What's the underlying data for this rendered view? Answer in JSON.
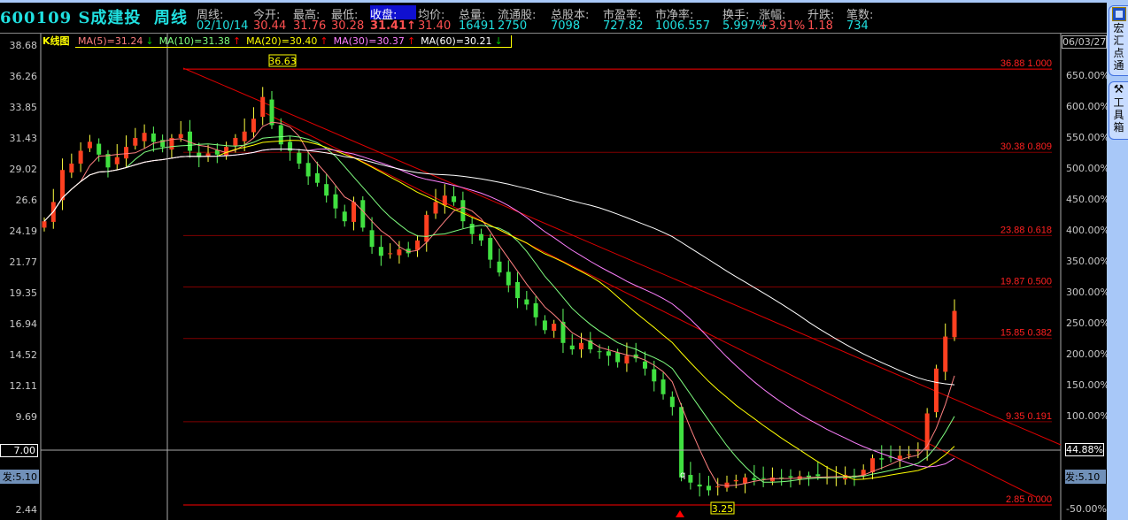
{
  "header": {
    "code": "600109",
    "name": "S成建投",
    "period": "周线",
    "fields": [
      {
        "label": "周线:",
        "value": "02/10/14",
        "color": "#20e0e0"
      },
      {
        "label": "今开:",
        "value": "30.44",
        "color": "#ff5050"
      },
      {
        "label": "最高:",
        "value": "31.76",
        "color": "#ff5050"
      },
      {
        "label": "最低:",
        "value": "30.28",
        "color": "#ff5050"
      },
      {
        "label": "收盘:",
        "value": "31.41↑",
        "color": "#ff5050",
        "highlight": true
      },
      {
        "label": "均价:",
        "value": "31.40",
        "color": "#ff5050"
      },
      {
        "label": "总量:",
        "value": "16491",
        "color": "#20e0e0"
      },
      {
        "label": "流通股:",
        "value": "2750",
        "color": "#20e0e0"
      },
      {
        "label": "总股本:",
        "value": "7098",
        "color": "#20e0e0"
      },
      {
        "label": "市盈率:",
        "value": "727.82",
        "color": "#20e0e0"
      },
      {
        "label": "市净率:",
        "value": "1006.557",
        "color": "#20e0e0"
      },
      {
        "label": "换手:",
        "value": "5.997%",
        "color": "#20e0e0"
      },
      {
        "label": "涨幅:",
        "value": "+3.91%",
        "color": "#ff5050"
      },
      {
        "label": "升跌:",
        "value": "1.18",
        "color": "#ff5050"
      },
      {
        "label": "笔数:",
        "value": "734",
        "color": "#20e0e0"
      }
    ]
  },
  "legend": {
    "chart_label": "K线图",
    "ma": [
      {
        "text": "MA(5)=31.24",
        "arrow": "↓",
        "color": "#ff8080",
        "arrow_color": "#00c000"
      },
      {
        "text": "MA(10)=31.38",
        "arrow": "↑",
        "color": "#80ff80",
        "arrow_color": "#ff0000"
      },
      {
        "text": "MA(20)=30.40",
        "arrow": "↑",
        "color": "#ffff00",
        "arrow_color": "#ff0000"
      },
      {
        "text": "MA(30)=30.37",
        "arrow": "↑",
        "color": "#ff80ff",
        "arrow_color": "#ff0000"
      },
      {
        "text": "MA(60)=30.21",
        "arrow": "↓",
        "color": "#ffffff",
        "arrow_color": "#00c000"
      }
    ]
  },
  "sidebar": {
    "tabs": [
      {
        "label": "宏汇点通",
        "icon": "hongdian-logo-icon"
      },
      {
        "label": "工具箱",
        "icon": "tools-icon"
      }
    ]
  },
  "chart_data": {
    "type": "candlestick",
    "ylim": [
      2.44,
      38.68
    ],
    "left_ticks": [
      "38.68",
      "36.26",
      "33.85",
      "31.43",
      "29.02",
      "26.6",
      "24.19",
      "21.77",
      "19.35",
      "16.94",
      "14.52",
      "12.11",
      "9.69",
      "2.44"
    ],
    "right_ticks": [
      "650.00%",
      "600.00%",
      "550.00%",
      "500.00%",
      "450.00%",
      "400.00%",
      "350.00%",
      "300.00%",
      "250.00%",
      "200.00%",
      "150.00%",
      "100.00%",
      "-50.00%"
    ],
    "crosshair": {
      "price": "7.00",
      "percent": "44.88%"
    },
    "issue_price_label": "发:5.10",
    "date_label": "06/03/27",
    "high_mark": "36.63",
    "low_mark": "3.25",
    "point_marker": "q",
    "fib_levels": [
      {
        "price": "36.88",
        "ratio": "1.000"
      },
      {
        "price": "30.38",
        "ratio": "0.809"
      },
      {
        "price": "23.88",
        "ratio": "0.618"
      },
      {
        "price": "19.87",
        "ratio": "0.500"
      },
      {
        "price": "15.85",
        "ratio": "0.382"
      },
      {
        "price": "9.35",
        "ratio": "0.191"
      },
      {
        "price": "2.85",
        "ratio": "0.000"
      }
    ],
    "closes": [
      25.0,
      26.5,
      29.0,
      29.5,
      30.5,
      31.2,
      30.2,
      29.2,
      30.0,
      30.8,
      31.5,
      31.9,
      31.2,
      30.8,
      31.5,
      31.8,
      30.5,
      30.0,
      30.3,
      30.2,
      30.8,
      31.5,
      32.0,
      33.0,
      34.7,
      32.5,
      31.0,
      30.5,
      29.5,
      28.5,
      28.0,
      27.0,
      26.0,
      25.0,
      26.5,
      24.5,
      23.0,
      22.3,
      22.5,
      22.8,
      22.5,
      23.5,
      25.5,
      26.5,
      27.0,
      26.5,
      25.0,
      24.0,
      23.5,
      22.0,
      21.0,
      20.0,
      19.0,
      18.5,
      17.5,
      16.5,
      17.0,
      15.5,
      15.0,
      15.5,
      15.0,
      14.8,
      14.5,
      14.0,
      14.5,
      14.3,
      13.5,
      12.5,
      11.5,
      10.5,
      5.0,
      4.6,
      4.3,
      4.0,
      4.3,
      4.6,
      4.8,
      5.0,
      4.8,
      4.9,
      5.0,
      4.9,
      5.0,
      5.1,
      5.0,
      5.1,
      5.0,
      5.1,
      5.2,
      5.0,
      5.6,
      6.5,
      6.4,
      6.6,
      6.7,
      6.8,
      7.2,
      10.0,
      13.5,
      16.0,
      18.0
    ],
    "ma_periods": [
      5,
      10,
      20,
      30,
      60
    ],
    "colors": {
      "up": "#ff4020",
      "down": "#40e040",
      "ma5": "#ff8080",
      "ma10": "#80ff80",
      "ma20": "#ffff00",
      "ma30": "#ff80ff",
      "ma60": "#ffffff",
      "fib": "#ff0000"
    }
  }
}
